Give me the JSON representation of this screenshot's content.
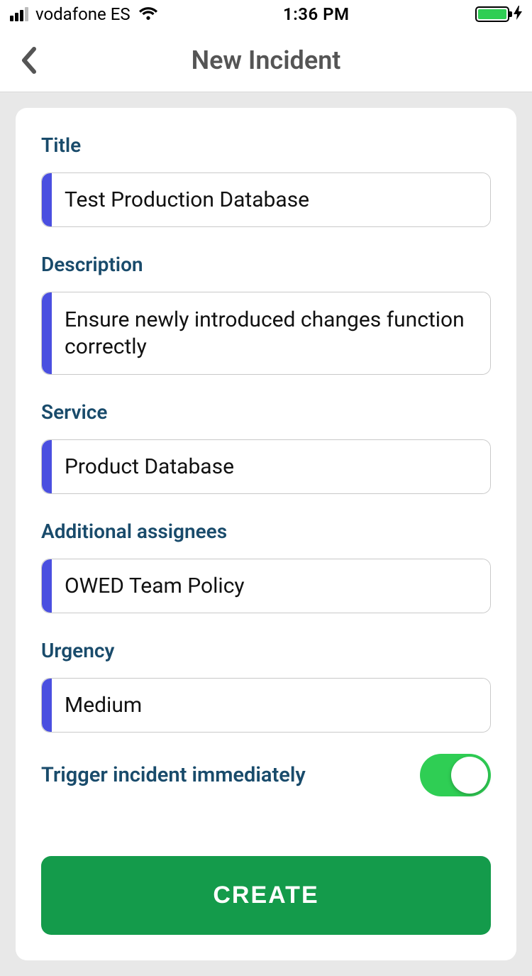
{
  "status": {
    "carrier": "vodafone ES",
    "time": "1:36 PM"
  },
  "header": {
    "title": "New Incident"
  },
  "form": {
    "title_label": "Title",
    "title_value": "Test Production Database",
    "description_label": "Description",
    "description_value": "Ensure newly introduced changes function correctly",
    "service_label": "Service",
    "service_value": "Product Database",
    "assignees_label": "Additional assignees",
    "assignees_value": "OWED Team Policy",
    "urgency_label": "Urgency",
    "urgency_value": "Medium",
    "trigger_label": "Trigger incident immediately",
    "trigger_on": true,
    "create_label": "CREATE"
  },
  "colors": {
    "accent": "#4a4fe0",
    "label": "#194b6b",
    "primary": "#149b4b",
    "toggle_on": "#2fce54"
  }
}
